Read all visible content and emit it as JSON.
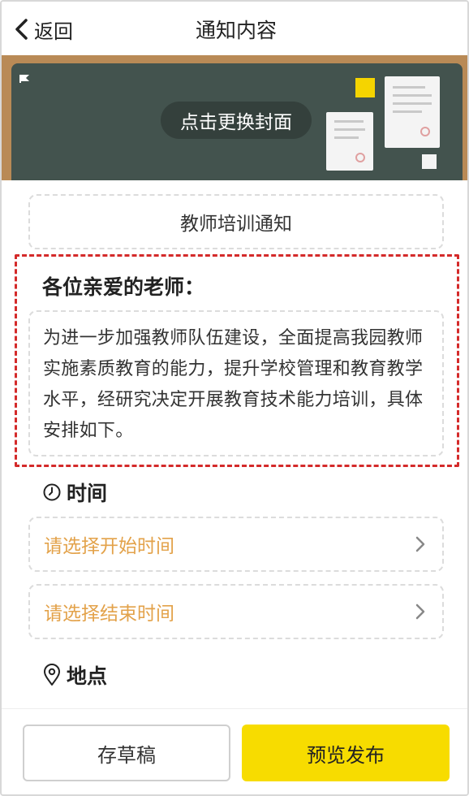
{
  "header": {
    "back_label": "返回",
    "title": "通知内容"
  },
  "cover": {
    "change_label": "点击更换封面"
  },
  "notice": {
    "title": "教师培训通知",
    "greeting": "各位亲爱的老师：",
    "body": "为进一步加强教师队伍建设，全面提高我园教师实施素质教育的能力，提升学校管理和教育教学水平，经研究决定开展教育技术能力培训，具体安排如下。"
  },
  "time_section": {
    "label": "时间",
    "start_placeholder": "请选择开始时间",
    "end_placeholder": "请选择结束时间"
  },
  "location_section": {
    "label": "地点"
  },
  "footer": {
    "draft_label": "存草稿",
    "publish_label": "预览发布"
  },
  "colors": {
    "accent_yellow": "#f7dc00",
    "placeholder_orange": "#e3a24a",
    "highlight_red": "#d42a2a",
    "board_green": "#43534e"
  },
  "icons": [
    "back-chevron-icon",
    "clock-icon",
    "location-pin-icon",
    "chevron-right-icon"
  ]
}
